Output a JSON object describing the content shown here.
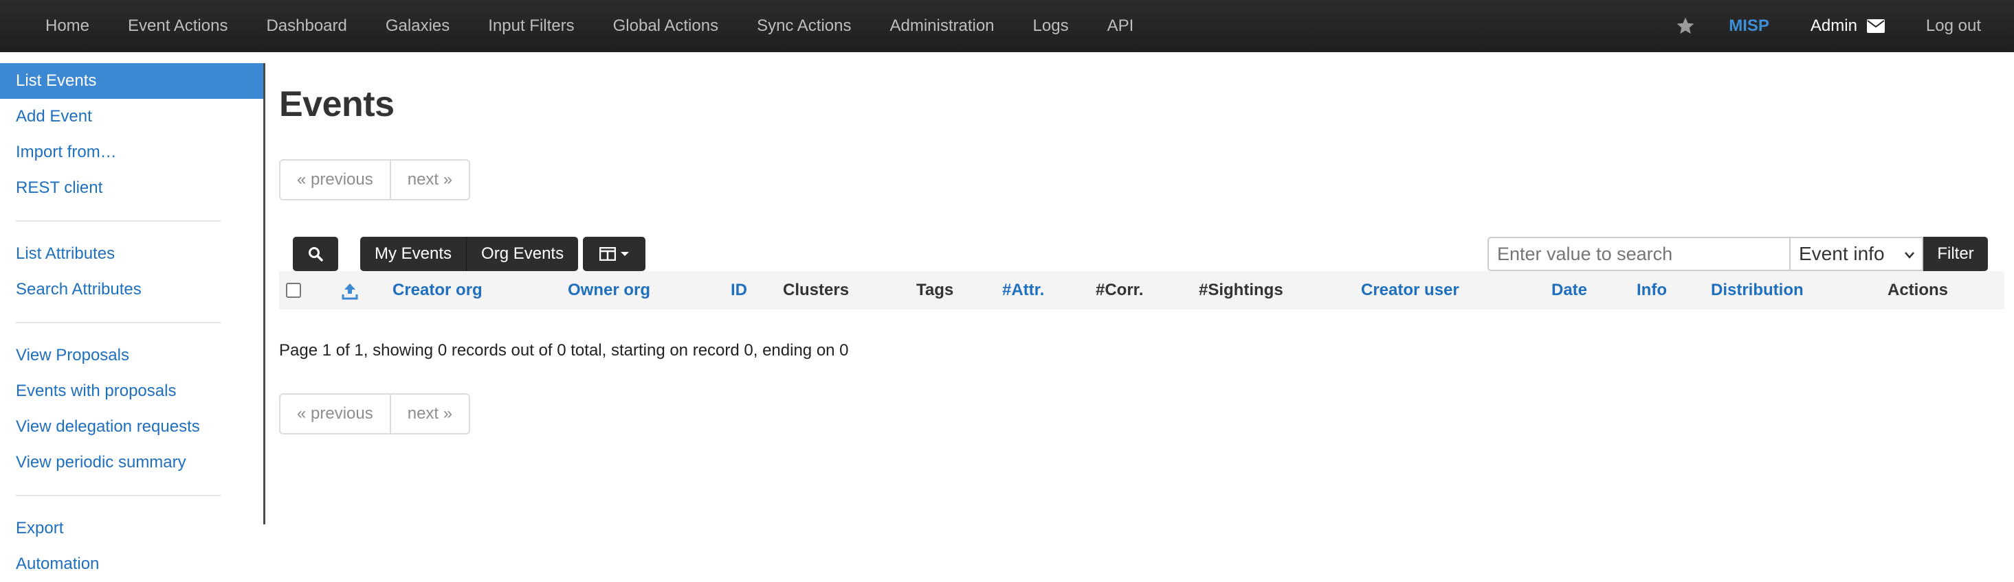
{
  "nav": {
    "items": [
      "Home",
      "Event Actions",
      "Dashboard",
      "Galaxies",
      "Input Filters",
      "Global Actions",
      "Sync Actions",
      "Administration",
      "Logs",
      "API"
    ],
    "brand": "MISP",
    "user": "Admin",
    "logout": "Log out"
  },
  "sidebar": {
    "groups": [
      [
        "List Events",
        "Add Event",
        "Import from…",
        "REST client"
      ],
      [
        "List Attributes",
        "Search Attributes"
      ],
      [
        "View Proposals",
        "Events with proposals",
        "View delegation requests",
        "View periodic summary"
      ],
      [
        "Export",
        "Automation"
      ]
    ]
  },
  "main": {
    "title": "Events",
    "pager": {
      "previous": "« previous",
      "next": "next »"
    },
    "toolbar": {
      "my_events": "My Events",
      "org_events": "Org Events",
      "filter": "Filter"
    },
    "search": {
      "placeholder": "Enter value to search",
      "field": "Event info"
    },
    "columns": [
      "Creator org",
      "Owner org",
      "ID",
      "Clusters",
      "Tags",
      "#Attr.",
      "#Corr.",
      "#Sightings",
      "Creator user",
      "Date",
      "Info",
      "Distribution",
      "Actions"
    ],
    "summary": "Page 1 of 1, showing 0 records out of 0 total, starting on record 0, ending on 0"
  },
  "colors": {
    "navbar": "#222222",
    "link": "#1f6fbf",
    "active": "#3c88d2",
    "brand": "#3c8fd8"
  },
  "icons": [
    "star-icon",
    "envelope-icon",
    "search-icon",
    "columns-icon",
    "caret-down-icon",
    "upload-icon"
  ]
}
